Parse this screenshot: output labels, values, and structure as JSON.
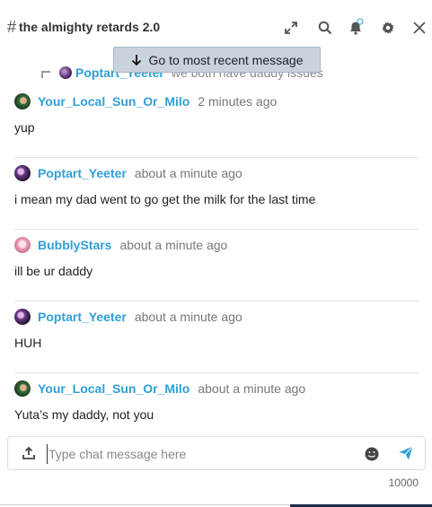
{
  "header": {
    "hash": "#",
    "title": "the almighty retards 2.0"
  },
  "icons": {
    "expand": "expand-icon",
    "search": "search-icon",
    "bell": "bell-icon",
    "settings": "gear-icon",
    "close": "close-icon"
  },
  "jump": {
    "label": "Go to most recent message"
  },
  "reply_preview": {
    "username": "Poptart_Yeeter",
    "text": "we both have daddy issues"
  },
  "messages": [
    {
      "username": "Your_Local_Sun_Or_Milo",
      "timestamp": "2 minutes ago",
      "text": "yup"
    },
    {
      "username": "Poptart_Yeeter",
      "timestamp": "about a minute ago",
      "text": "i mean my dad went to go get the milk for the last time"
    },
    {
      "username": "BubblyStars",
      "timestamp": "about a minute ago",
      "text": "ill be ur daddy"
    },
    {
      "username": "Poptart_Yeeter",
      "timestamp": "about a minute ago",
      "text": "HUH"
    },
    {
      "username": "Your_Local_Sun_Or_Milo",
      "timestamp": "about a minute ago",
      "text": "Yuta’s my daddy, not you"
    }
  ],
  "composer": {
    "placeholder": "Type chat message here",
    "value": "",
    "char_limit": "10000"
  },
  "colors": {
    "username": "#2f9fd6",
    "send": "#2f9fd6",
    "jump_bg": "#c9d3de"
  }
}
